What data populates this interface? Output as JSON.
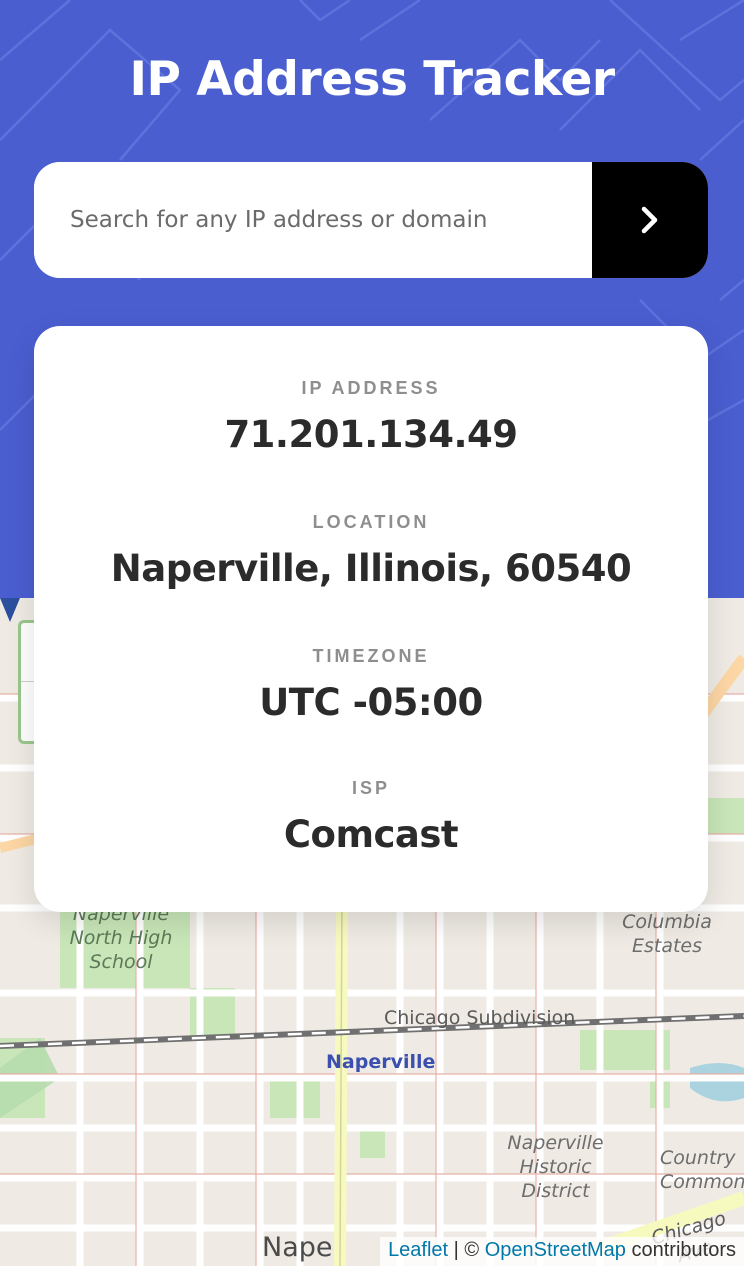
{
  "header": {
    "title": "IP Address Tracker",
    "background_color": "#4a5ed0"
  },
  "search": {
    "placeholder": "Search for any IP address or domain",
    "value": "",
    "button_icon": "chevron-right-icon"
  },
  "info": {
    "ip_label": "IP ADDRESS",
    "ip_value": "71.201.134.49",
    "location_label": "LOCATION",
    "location_value": "Naperville, Illinois, 60540",
    "timezone_label": "TIMEZONE",
    "timezone_value": "UTC -05:00",
    "isp_label": "ISP",
    "isp_value": "Comcast"
  },
  "map": {
    "labels": {
      "school": "Naperville North High School",
      "columbia": "Columbia Estates",
      "chicago_subdivision": "Chicago Subdivision",
      "naperville": "Naperville",
      "historic": "Naperville Historic District",
      "country": "Country Common",
      "chicago_ave": "Chicago Ave",
      "nape": "Nape"
    },
    "attribution": {
      "leaflet": "Leaflet",
      "separator": " | © ",
      "osm": "OpenStreetMap",
      "suffix": " contributors"
    }
  }
}
